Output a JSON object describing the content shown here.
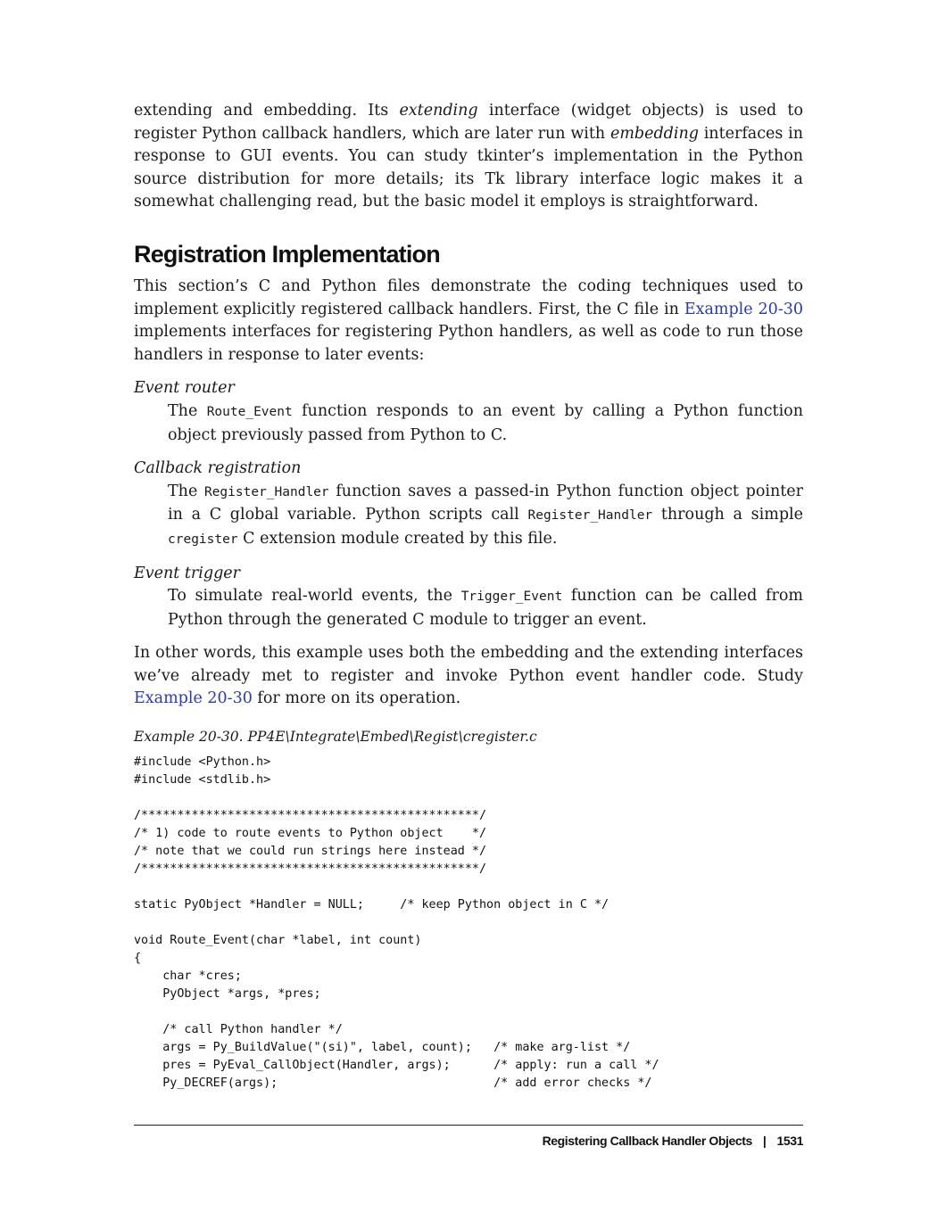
{
  "intro": {
    "t1": "extending and embedding. Its ",
    "em1": "extending",
    "t2": " interface (widget objects) is used to register Python callback handlers, which are later run with ",
    "em2": "embedding",
    "t3": " interfaces in response to GUI events. You can study tkinter’s implementation in the Python source distribution for more details; its Tk library interface logic makes it a somewhat challenging read, but the basic model it employs is straightforward."
  },
  "section": {
    "title": "Registration Implementation",
    "p1_a": "This section’s C and Python files demonstrate the coding techniques used to implement explicitly registered callback handlers. First, the C file in ",
    "p1_link": "Example 20-30",
    "p1_b": " implements interfaces for registering Python handlers, as well as code to run those handlers in response to later events:"
  },
  "items": [
    {
      "term": "Event router",
      "d_a": "The ",
      "d_code": "Route_Event",
      "d_b": " function responds to an event by calling a Python function object previously passed from Python to C."
    },
    {
      "term": "Callback registration",
      "d_a": "The ",
      "d_code": "Register_Handler",
      "d_b": " function saves a passed-in Python function object pointer in a C global variable. Python scripts call ",
      "d_code2": "Register_Handler",
      "d_c": " through a simple ",
      "d_code3": "cregister",
      "d_d": " C extension module created by this file."
    },
    {
      "term": "Event trigger",
      "d_a": "To simulate real-world events, the ",
      "d_code": "Trigger_Event",
      "d_b": " function can be called from Python through the generated C module to trigger an event."
    }
  ],
  "closing": {
    "a": "In other words, this example uses both the embedding and the extending interfaces we’ve already met to register and invoke Python event handler code. Study ",
    "link": "Example 20-30",
    "b": " for more on its operation."
  },
  "example": {
    "caption": "Example 20-30. PP4E\\Integrate\\Embed\\Regist\\cregister.c",
    "code": "#include <Python.h>\n#include <stdlib.h>\n\n/***********************************************/\n/* 1) code to route events to Python object    */\n/* note that we could run strings here instead */\n/***********************************************/\n\nstatic PyObject *Handler = NULL;     /* keep Python object in C */\n\nvoid Route_Event(char *label, int count)\n{\n    char *cres;\n    PyObject *args, *pres;\n\n    /* call Python handler */\n    args = Py_BuildValue(\"(si)\", label, count);   /* make arg-list */\n    pres = PyEval_CallObject(Handler, args);      /* apply: run a call */\n    Py_DECREF(args);                              /* add error checks */"
  },
  "footer": {
    "title": "Registering Callback Handler Objects",
    "separator": "|",
    "page": "1531"
  }
}
